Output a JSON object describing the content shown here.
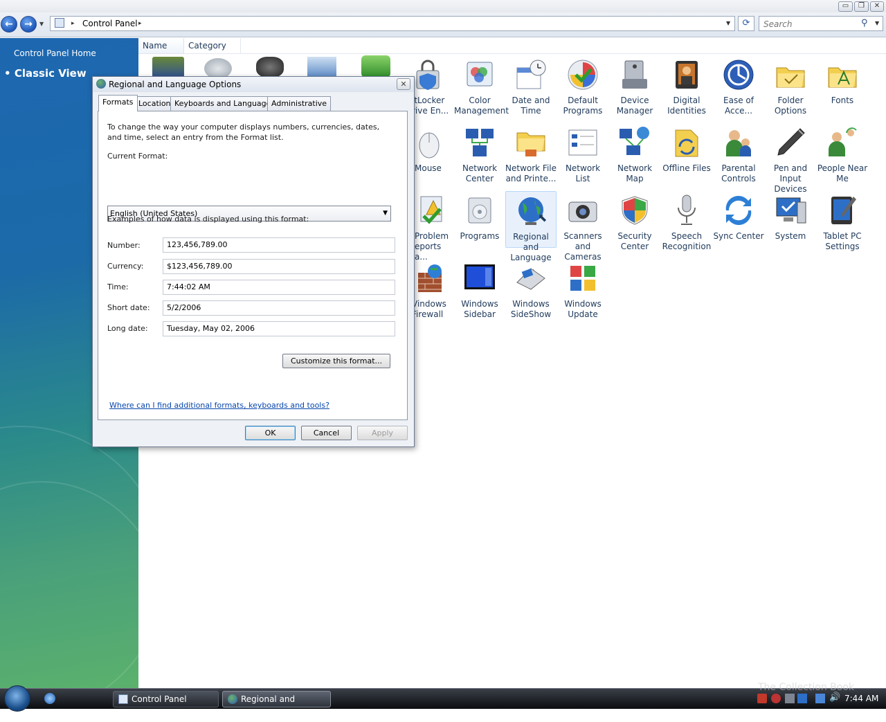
{
  "window": {
    "minimize": "▭",
    "maximize": "❐",
    "close": "✕"
  },
  "nav": {
    "back": "←",
    "forward": "→",
    "breadcrumb": "Control Panel",
    "search_placeholder": "Search"
  },
  "leftpane": {
    "home_link": "Control Panel Home",
    "classic_view": "Classic View"
  },
  "columns": [
    "Name",
    "Category"
  ],
  "items": [
    {
      "label": "BitLocker Drive En...",
      "shown": "itLocker\nrive En..."
    },
    {
      "label": "Color Management"
    },
    {
      "label": "Date and Time"
    },
    {
      "label": "Default Programs"
    },
    {
      "label": "Device Manager"
    },
    {
      "label": "Digital Identities"
    },
    {
      "label": "Ease of Acce..."
    },
    {
      "label": "Folder Options"
    },
    {
      "label": "Fonts"
    },
    {
      "label": "Mouse"
    },
    {
      "label": "Network Center"
    },
    {
      "label": "Network File and Printe..."
    },
    {
      "label": "Network List"
    },
    {
      "label": "Network Map"
    },
    {
      "label": "Offline Files"
    },
    {
      "label": "Parental Controls"
    },
    {
      "label": "Pen and Input Devices"
    },
    {
      "label": "People Near Me"
    },
    {
      "label": "Problem Reports a...",
      "shown": "Problem\neports a..."
    },
    {
      "label": "Programs"
    },
    {
      "label": "Regional and Language ..."
    },
    {
      "label": "Scanners and Cameras"
    },
    {
      "label": "Security Center"
    },
    {
      "label": "Speech Recognition"
    },
    {
      "label": "Sync Center"
    },
    {
      "label": "System"
    },
    {
      "label": "Tablet PC Settings"
    },
    {
      "label": "Windows Firewall",
      "shown": "Vindows\nFirewall"
    },
    {
      "label": "Windows Sidebar"
    },
    {
      "label": "Windows SideShow"
    },
    {
      "label": "Windows Update"
    }
  ],
  "dialog": {
    "title": "Regional and Language Options",
    "tabs": [
      "Formats",
      "Location",
      "Keyboards and Languages",
      "Administrative"
    ],
    "active_tab": "Formats",
    "intro": "To change the way your computer displays numbers, currencies, dates, and time, select an entry from the Format list.",
    "current_format_label": "Current Format:",
    "current_format_value": "English (United States)",
    "examples_label": "Examples of how data is displayed using this format:",
    "examples": [
      {
        "label": "Number:",
        "value": "123,456,789.00"
      },
      {
        "label": "Currency:",
        "value": "$123,456,789.00"
      },
      {
        "label": "Time:",
        "value": "7:44:02 AM"
      },
      {
        "label": "Short date:",
        "value": "5/2/2006"
      },
      {
        "label": "Long date:",
        "value": "Tuesday, May 02, 2006"
      }
    ],
    "customize_button": "Customize this format...",
    "help_link": "Where can I find additional formats, keyboards and tools?",
    "ok": "OK",
    "cancel": "Cancel",
    "apply": "Apply"
  },
  "taskbar": {
    "tasks": [
      "Control Panel",
      "Regional and Langu..."
    ],
    "clock": "7:44 AM",
    "watermark": "The Collection Book"
  },
  "colors": {
    "accent": "#1d56b7",
    "link": "#0645ad",
    "item_text": "#1e395b"
  }
}
